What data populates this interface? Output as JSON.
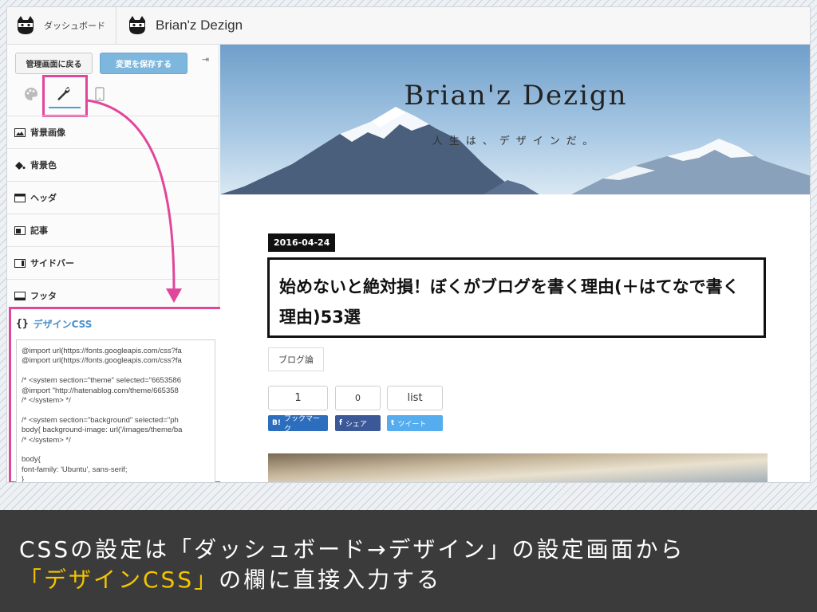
{
  "topbar": {
    "dashboard_label": "ダッシュボード",
    "blog_name": "Brian'z Dezign"
  },
  "sidebar": {
    "back_button": "管理画面に戻る",
    "save_button": "変更を保存する",
    "collapse_icon": "collapse-icon",
    "tabs": [
      {
        "name": "palette-icon",
        "active": false
      },
      {
        "name": "wrench-icon",
        "active": true
      },
      {
        "name": "phone-icon",
        "active": false
      }
    ],
    "menu": [
      {
        "label": "背景画像",
        "icon": "image-icon"
      },
      {
        "label": "背景色",
        "icon": "paint-bucket-icon"
      },
      {
        "label": "ヘッダ",
        "icon": "header-layout-icon"
      },
      {
        "label": "記事",
        "icon": "article-layout-icon"
      },
      {
        "label": "サイドバー",
        "icon": "sidebar-layout-icon"
      },
      {
        "label": "フッタ",
        "icon": "footer-layout-icon"
      }
    ],
    "css_panel": {
      "brace": "{}",
      "title": "デザインCSS",
      "code_lines": [
        "@import url(https://fonts.googleapis.com/css?fa",
        "@import url(https://fonts.googleapis.com/css?fa",
        "",
        "/* <system section=\"theme\" selected=\"6653586",
        "@import \"http://hatenablog.com/theme/665358",
        "/* </system> */",
        "",
        "/* <system section=\"background\" selected=\"ph",
        "body{ background-image: url('/images/theme/ba",
        "/* </system> */",
        "",
        "body{",
        "font-family: 'Ubuntu', sans-serif;",
        "}"
      ]
    }
  },
  "preview": {
    "site_title": "Brian'z Dezign",
    "site_subtitle": "人生は、デザインだ。",
    "date": "2016-04-24",
    "post_title": "始めないと絶対損！ぼくがブログを書く理由(＋はてなで書く理由)53選",
    "category": "ブログ論",
    "share_counts": [
      "1",
      "0",
      "list"
    ],
    "share_buttons": [
      {
        "icon": "B!",
        "label": "ブックマーク",
        "color": "#2c6ebd"
      },
      {
        "icon": "f",
        "label": "シェア",
        "color": "#3b5998"
      },
      {
        "icon": "t",
        "label": "ツイート",
        "color": "#55acee"
      }
    ]
  },
  "caption": {
    "line1": "CSSの設定は「ダッシュボード→デザイン」の設定画面から",
    "line2_highlight": "「デザインCSS」",
    "line2_rest": "の欄に直接入力する"
  },
  "colors": {
    "highlight_pink": "#e0469a",
    "caption_bg": "#3b3b3b",
    "caption_highlight": "#f5c400",
    "save_button": "#7db7de"
  }
}
